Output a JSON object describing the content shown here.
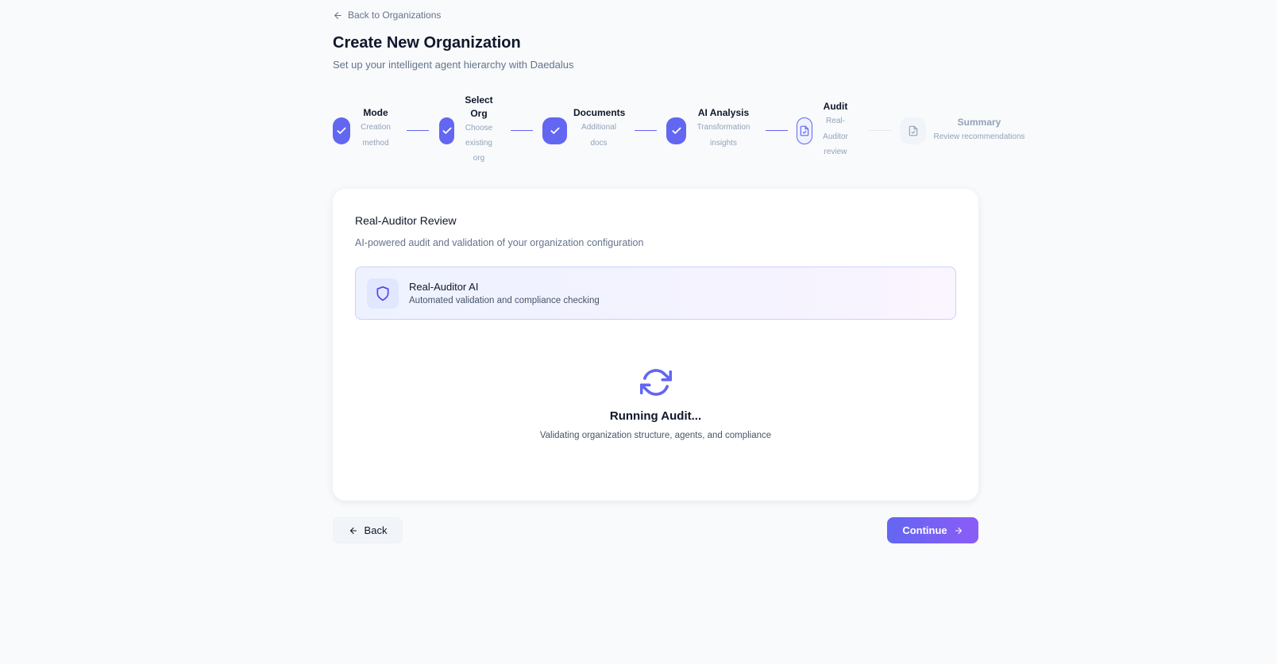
{
  "nav": {
    "back_link": "Back to Organizations"
  },
  "header": {
    "title": "Create New Organization",
    "subtitle": "Set up your intelligent agent hierarchy with Daedalus"
  },
  "stepper": {
    "steps": [
      {
        "label": "Mode",
        "desc_lines": [
          "Creation",
          "method"
        ],
        "status": "done"
      },
      {
        "label_lines": [
          "Select",
          "Org"
        ],
        "desc_lines": [
          "Choose",
          "existing",
          "org"
        ],
        "status": "done"
      },
      {
        "label": "Documents",
        "desc_lines": [
          "Additional",
          "docs"
        ],
        "status": "done"
      },
      {
        "label": "AI Analysis",
        "desc_lines": [
          "Transformation",
          "insights"
        ],
        "status": "done"
      },
      {
        "label": "Audit",
        "desc_lines": [
          "Real-",
          "Auditor",
          "review"
        ],
        "status": "active"
      },
      {
        "label": "Summary",
        "desc_lines": [
          "Review recommendations"
        ],
        "status": "pending"
      }
    ]
  },
  "card": {
    "title": "Real-Auditor Review",
    "subtitle": "AI-powered audit and validation of your organization configuration",
    "auditor": {
      "name": "Real-Auditor AI",
      "description": "Automated validation and compliance checking",
      "icon": "shield-icon"
    },
    "status": {
      "icon": "refresh-icon",
      "title": "Running Audit...",
      "description": "Validating organization structure, agents, and compliance"
    }
  },
  "footer": {
    "back_label": "Back",
    "continue_label": "Continue"
  },
  "colors": {
    "accent": "#6366f1",
    "accent_end": "#8b5cf6",
    "background": "#f8fafc",
    "muted_text": "#94a3b8"
  }
}
